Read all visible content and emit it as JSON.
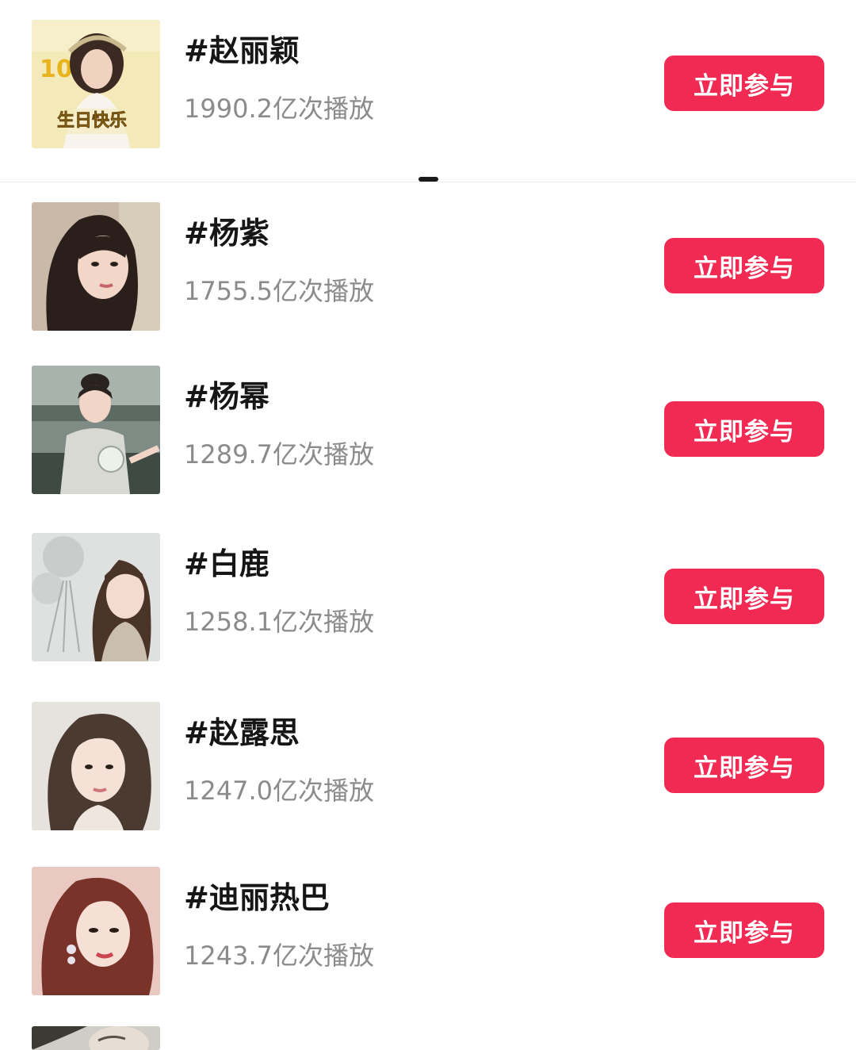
{
  "rows": [
    {
      "title": "#赵丽颖",
      "count": "1990.2亿次播放",
      "button": "立即参与",
      "thumb_text": "生日快乐",
      "thumb_number": "1016"
    },
    {
      "title": "#杨紫",
      "count": "1755.5亿次播放",
      "button": "立即参与"
    },
    {
      "title": "#杨幂",
      "count": "1289.7亿次播放",
      "button": "立即参与"
    },
    {
      "title": "#白鹿",
      "count": "1258.1亿次播放",
      "button": "立即参与"
    },
    {
      "title": "#赵露思",
      "count": "1247.0亿次播放",
      "button": "立即参与"
    },
    {
      "title": "#迪丽热巴",
      "count": "1243.7亿次播放",
      "button": "立即参与"
    }
  ],
  "colors": {
    "button_bg": "#f02a52",
    "title_text": "#161616",
    "count_text": "#8b8b8b"
  },
  "icons": {
    "drag_handle": "drag-handle-icon"
  }
}
